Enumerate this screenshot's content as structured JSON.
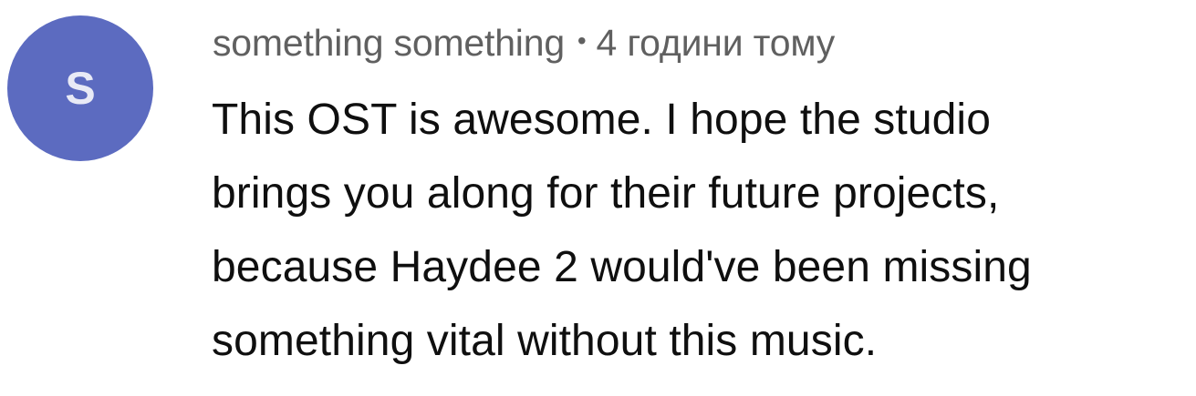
{
  "comment": {
    "avatar_letter": "S",
    "avatar_color": "#5c6bc0",
    "author": "something something",
    "separator": "•",
    "timestamp": "4 години тому",
    "text_lines": [
      "This OST is awesome. I hope the studio",
      "brings you along for their future projects,",
      "because Haydee 2 would've been missing",
      "something vital without this music."
    ]
  }
}
